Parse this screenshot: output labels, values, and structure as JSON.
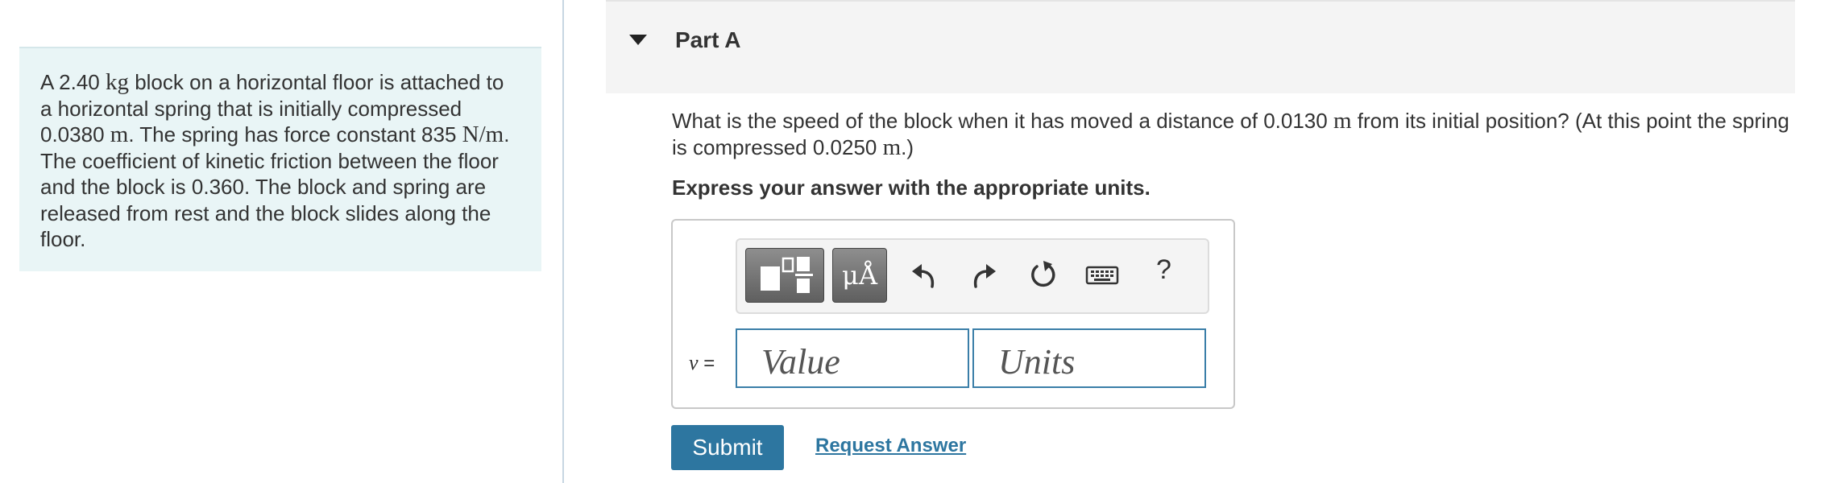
{
  "problem": {
    "t1": "A 2.40 ",
    "unit_kg": "kg",
    "t2": " block on a horizontal floor is attached to a horizontal spring that is initially compressed 0.0380 ",
    "unit_m": "m",
    "t3": ". The spring has force constant 835 ",
    "unit_nm": "N/m",
    "t4": ". The coefficient of kinetic friction between the floor and the block is 0.360. The block and spring are released from rest and the block slides along the floor."
  },
  "part": {
    "title": "Part A"
  },
  "question": {
    "t1": "What is the speed of the block when it has moved a distance of 0.0130 ",
    "unit_1": "m",
    "t2": " from its initial position? (At this point the spring is compressed 0.0250 ",
    "unit_2": "m",
    "t3": ".)"
  },
  "instruction": "Express your answer with the appropriate units.",
  "toolbar": {
    "symbols_label": "μÅ",
    "help_label": "?",
    "icons": [
      "templates-icon",
      "undo-icon",
      "redo-icon",
      "reset-icon",
      "keyboard-icon",
      "help-icon"
    ]
  },
  "answer": {
    "variable": "v",
    "equals": " =",
    "value_placeholder": "Value",
    "units_placeholder": "Units"
  },
  "actions": {
    "submit_label": "Submit",
    "request_label": "Request Answer"
  },
  "colors": {
    "problem_bg": "#e9f5f6",
    "accent": "#2d76a0",
    "header_bg": "#f4f4f4"
  }
}
